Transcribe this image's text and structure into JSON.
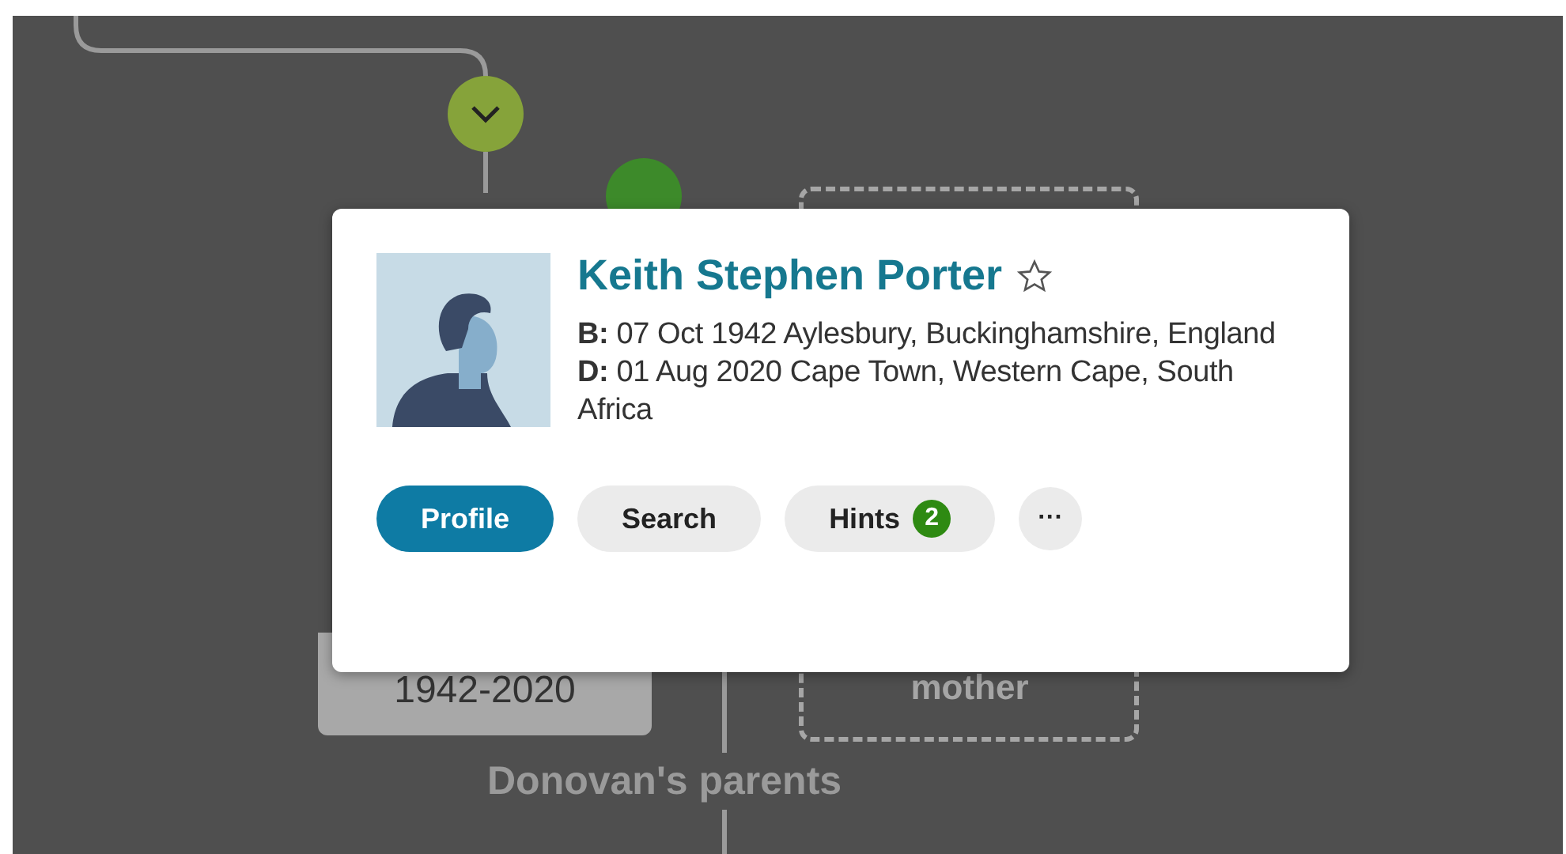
{
  "tree": {
    "node_dates": "1942-2020",
    "placeholder_label": "mother",
    "group_label": "Donovan's parents"
  },
  "person_card": {
    "name": "Keith Stephen Porter",
    "favorite": false,
    "birth": "**B:** 07 Oct 1942 Aylesbury, Buckinghamshire, England",
    "death": "**D:** 01 Aug 2020 Cape Town, Western Cape, South Africa",
    "buttons": [
      {
        "kind": "primary",
        "label": "Profile"
      },
      {
        "kind": "secondary",
        "label": "Search"
      },
      {
        "kind": "badge",
        "label": "Hints",
        "count": "2"
      },
      {
        "kind": "more",
        "label": "···"
      }
    ]
  }
}
